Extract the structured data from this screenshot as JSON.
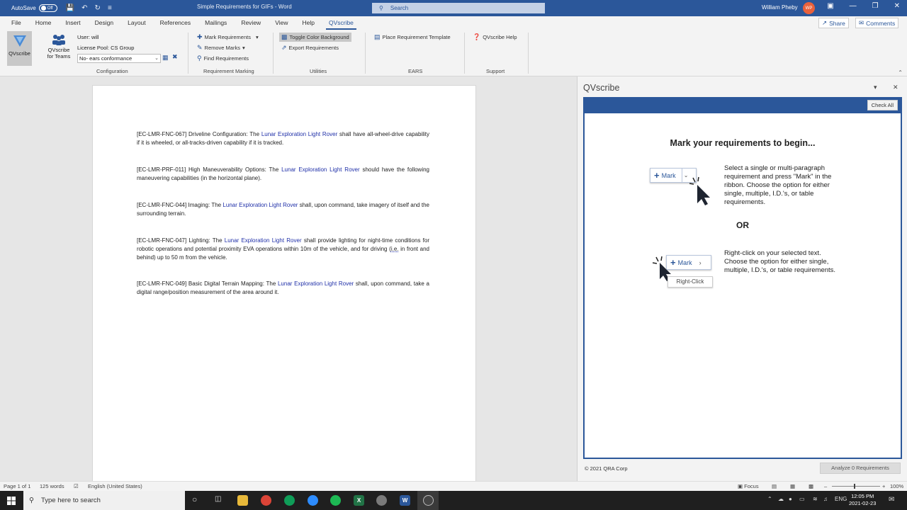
{
  "titlebar": {
    "autosave_label": "AutoSave",
    "autosave_state": "Off",
    "doc_title": "Simple Requirements for GIFs  -  Word",
    "search_placeholder": "Search",
    "user_name": "William Pheby",
    "user_initials": "WP"
  },
  "menu": {
    "tabs": [
      "File",
      "Home",
      "Insert",
      "Design",
      "Layout",
      "References",
      "Mailings",
      "Review",
      "View",
      "Help",
      "QVscribe"
    ],
    "active_tab": "QVscribe",
    "share_label": "Share",
    "comments_label": "Comments"
  },
  "ribbon": {
    "qvscribe_button": "QVscribe",
    "teams_button_line1": "QVscribe",
    "teams_button_line2": "for Teams",
    "user_label": "User: will",
    "license_label": "License Pool: CS Group",
    "config_select_value": "No- ears conformance",
    "groups": {
      "configuration": "Configuration",
      "requirement_marking": "Requirement Marking",
      "utilities": "Utilities",
      "ears": "EARS",
      "support": "Support"
    },
    "mark_requirements": "Mark Requirements",
    "remove_marks": "Remove Marks",
    "find_requirements": "Find Requirements",
    "toggle_color": "Toggle Color Background",
    "export_requirements": "Export Requirements",
    "place_template": "Place Requirement Template",
    "qvscribe_help": "QVscribe Help"
  },
  "document": {
    "paragraphs": [
      {
        "pre": "[EC-LMR-FNC-067] Driveline Configuration: The ",
        "entity": "Lunar Exploration Light Rover",
        "post": " shall have all-wheel-drive capability if it is wheeled, or all-tracks-driven capability if it is tracked."
      },
      {
        "pre": "[EC-LMR-PRF-011] High Maneuverability Options: The ",
        "entity": "Lunar Exploration Light Rover",
        "post": " should have the following maneuvering capabilities (in the horizontal plane)."
      },
      {
        "pre": "[EC-LMR-FNC-044] Imaging: The ",
        "entity": "Lunar Exploration Light Rover",
        "post": " shall, upon command, take imagery of itself and the surrounding terrain."
      },
      {
        "pre": "[EC-LMR-FNC-047] Lighting: The ",
        "entity": "Lunar Exploration Light Rover",
        "post": " shall provide lighting for night-time conditions for robotic operations and potential proximity EVA operations within 10m of the vehicle, and for driving (",
        "underline": "i.e.",
        "post2": " in front and behind) up to 50 m from the vehicle."
      },
      {
        "pre": "[EC-LMR-FNC-049] Basic Digital Terrain Mapping: The ",
        "entity": "Lunar Exploration Light Rover",
        "post": " shall, upon command, take a digital range/position measurement of the area around it."
      }
    ]
  },
  "pane": {
    "title": "QVscribe",
    "check_all": "Check All",
    "heading": "Mark your requirements to begin...",
    "instruction1": "Select a single or multi-paragraph requirement and press \"Mark\" in the ribbon. Choose the option for either single, multiple, I.D.'s, or table requirements.",
    "or_label": "OR",
    "instruction2": "Right-click on your selected text. Choose the option for either single, multiple, I.D.'s, or table requirements.",
    "mark_label": "Mark",
    "right_click_label": "Right-Click",
    "footer": "© 2021 QRA Corp",
    "analyze_button": "Analyze 0 Requirements"
  },
  "status": {
    "page": "Page 1 of 1",
    "words": "125 words",
    "language": "English (United States)",
    "focus": "Focus",
    "zoom": "100%"
  },
  "taskbar": {
    "search_placeholder": "Type here to search",
    "language": "ENG",
    "time": "12:05 PM",
    "date": "2021-02-23"
  },
  "colors": {
    "word_blue": "#2b579a",
    "entity_blue": "#1f2fa8",
    "avatar": "#e9613c"
  }
}
